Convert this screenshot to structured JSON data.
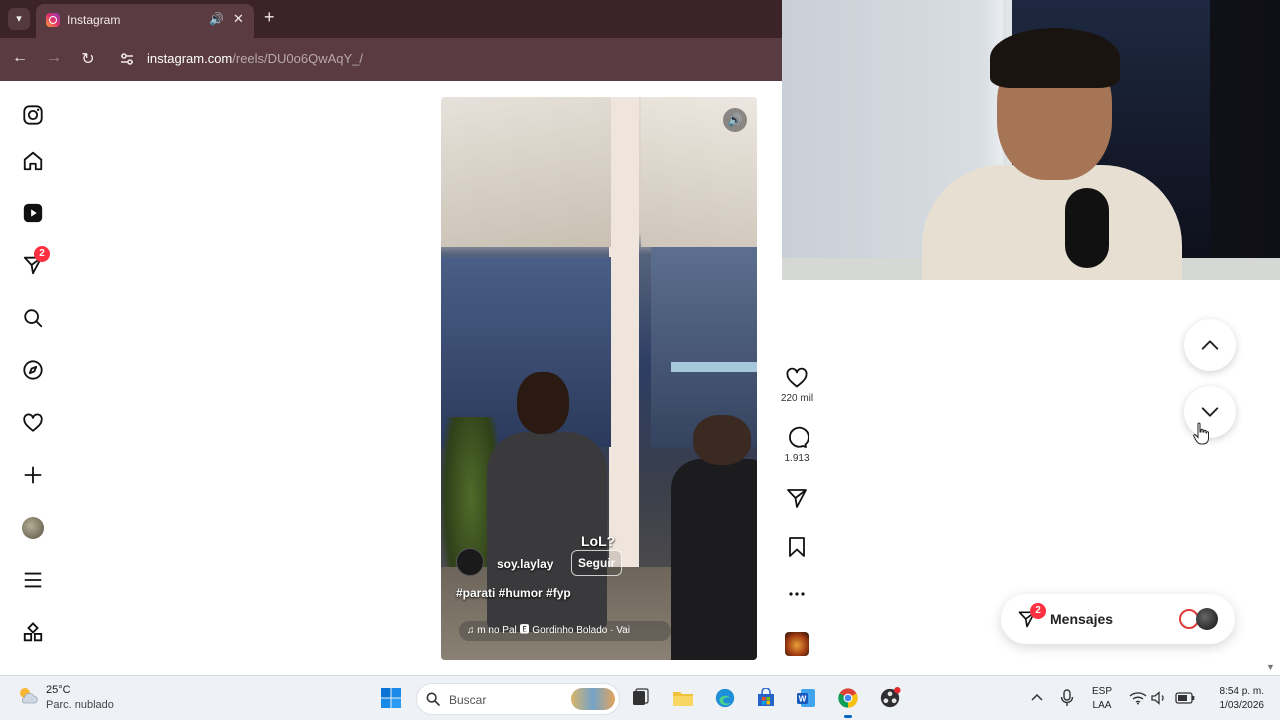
{
  "browser": {
    "tab_title": "Instagram",
    "url_host": "instagram.com",
    "url_path": "/reels/DU0o6QwAqY_/"
  },
  "sidebar": {
    "notifications_badge": "2"
  },
  "reel": {
    "overlay_text": "LoL?",
    "author": "soy.laylay",
    "follow_label": "Seguir",
    "hashtags": "#parati #humor #fyp",
    "audio": "♫  m no Pal  🅴  Gordinho Bolado · Vai"
  },
  "actions": {
    "likes": "220 mil",
    "comments": "1.913"
  },
  "messages": {
    "label": "Mensajes",
    "badge": "2"
  },
  "taskbar": {
    "temperature": "25°C",
    "condition": "Parc. nublado",
    "search_placeholder": "Buscar",
    "lang_line1": "ESP",
    "lang_line2": "LAA",
    "time": "8:54 p. m.",
    "date": "1/03/2026"
  },
  "colors": {
    "chrome_tabbar": "#3b2328",
    "chrome_toolbar": "#5a3b42",
    "badge_red": "#ff3040",
    "taskbar": "#eef1f6"
  }
}
